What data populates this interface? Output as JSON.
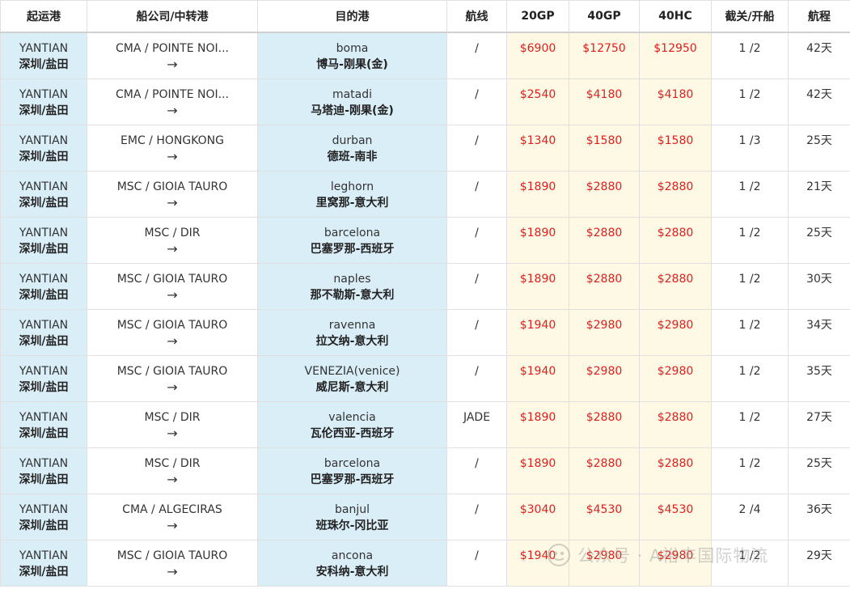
{
  "headers": {
    "origin": "起运港",
    "carrier": "船公司/中转港",
    "destination": "目的港",
    "route": "航线",
    "gp20": "20GP",
    "gp40": "40GP",
    "hc40": "40HC",
    "cutoff": "截关/开船",
    "transit": "航程"
  },
  "rows": [
    {
      "origin_en": "YANTIAN",
      "origin_cn": "深圳/盐田",
      "carrier": "CMA / POINTE NOI...",
      "arrow": "→",
      "dest_en": "boma",
      "dest_cn": "博马-刚果(金)",
      "route": "/",
      "gp20": "$6900",
      "gp40": "$12750",
      "hc40": "$12950",
      "cutoff": "1 /2",
      "transit": "42天"
    },
    {
      "origin_en": "YANTIAN",
      "origin_cn": "深圳/盐田",
      "carrier": "CMA / POINTE NOI...",
      "arrow": "→",
      "dest_en": "matadi",
      "dest_cn": "马塔迪-刚果(金)",
      "route": "/",
      "gp20": "$2540",
      "gp40": "$4180",
      "hc40": "$4180",
      "cutoff": "1 /2",
      "transit": "42天"
    },
    {
      "origin_en": "YANTIAN",
      "origin_cn": "深圳/盐田",
      "carrier": "EMC / HONGKONG",
      "arrow": "→",
      "dest_en": "durban",
      "dest_cn": "德班-南非",
      "route": "/",
      "gp20": "$1340",
      "gp40": "$1580",
      "hc40": "$1580",
      "cutoff": "1 /3",
      "transit": "25天"
    },
    {
      "origin_en": "YANTIAN",
      "origin_cn": "深圳/盐田",
      "carrier": "MSC / GIOIA TAURO",
      "arrow": "→",
      "dest_en": "leghorn",
      "dest_cn": "里窝那-意大利",
      "route": "/",
      "gp20": "$1890",
      "gp40": "$2880",
      "hc40": "$2880",
      "cutoff": "1 /2",
      "transit": "21天"
    },
    {
      "origin_en": "YANTIAN",
      "origin_cn": "深圳/盐田",
      "carrier": "MSC / DIR",
      "arrow": "→",
      "dest_en": "barcelona",
      "dest_cn": "巴塞罗那-西班牙",
      "route": "/",
      "gp20": "$1890",
      "gp40": "$2880",
      "hc40": "$2880",
      "cutoff": "1 /2",
      "transit": "25天"
    },
    {
      "origin_en": "YANTIAN",
      "origin_cn": "深圳/盐田",
      "carrier": "MSC / GIOIA TAURO",
      "arrow": "→",
      "dest_en": "naples",
      "dest_cn": "那不勒斯-意大利",
      "route": "/",
      "gp20": "$1890",
      "gp40": "$2880",
      "hc40": "$2880",
      "cutoff": "1 /2",
      "transit": "30天"
    },
    {
      "origin_en": "YANTIAN",
      "origin_cn": "深圳/盐田",
      "carrier": "MSC / GIOIA TAURO",
      "arrow": "→",
      "dest_en": "ravenna",
      "dest_cn": "拉文纳-意大利",
      "route": "/",
      "gp20": "$1940",
      "gp40": "$2980",
      "hc40": "$2980",
      "cutoff": "1 /2",
      "transit": "34天"
    },
    {
      "origin_en": "YANTIAN",
      "origin_cn": "深圳/盐田",
      "carrier": "MSC / GIOIA TAURO",
      "arrow": "→",
      "dest_en": "VENEZIA(venice)",
      "dest_cn": "威尼斯-意大利",
      "route": "/",
      "gp20": "$1940",
      "gp40": "$2980",
      "hc40": "$2980",
      "cutoff": "1 /2",
      "transit": "35天"
    },
    {
      "origin_en": "YANTIAN",
      "origin_cn": "深圳/盐田",
      "carrier": "MSC / DIR",
      "arrow": "→",
      "dest_en": "valencia",
      "dest_cn": "瓦伦西亚-西班牙",
      "route": "JADE",
      "gp20": "$1890",
      "gp40": "$2880",
      "hc40": "$2880",
      "cutoff": "1 /2",
      "transit": "27天"
    },
    {
      "origin_en": "YANTIAN",
      "origin_cn": "深圳/盐田",
      "carrier": "MSC / DIR",
      "arrow": "→",
      "dest_en": "barcelona",
      "dest_cn": "巴塞罗那-西班牙",
      "route": "/",
      "gp20": "$1890",
      "gp40": "$2880",
      "hc40": "$2880",
      "cutoff": "1 /2",
      "transit": "25天"
    },
    {
      "origin_en": "YANTIAN",
      "origin_cn": "深圳/盐田",
      "carrier": "CMA / ALGECIRAS",
      "arrow": "→",
      "dest_en": "banjul",
      "dest_cn": "班珠尔-冈比亚",
      "route": "/",
      "gp20": "$3040",
      "gp40": "$4530",
      "hc40": "$4530",
      "cutoff": "2 /4",
      "transit": "36天"
    },
    {
      "origin_en": "YANTIAN",
      "origin_cn": "深圳/盐田",
      "carrier": "MSC / GIOIA TAURO",
      "arrow": "→",
      "dest_en": "ancona",
      "dest_cn": "安科纳-意大利",
      "route": "/",
      "gp20": "$1940",
      "gp40": "$2980",
      "hc40": "$2980",
      "cutoff": "1 /2",
      "transit": "29天"
    }
  ],
  "watermark": {
    "text": "公众号 · A裕丰国际物流",
    "icon": "wechat-official-account-icon"
  },
  "colors": {
    "price_text": "#e02020",
    "origin_bg": "#daeef8",
    "dest_bg": "#daeef8",
    "price_bg": "#fdf9e4"
  }
}
